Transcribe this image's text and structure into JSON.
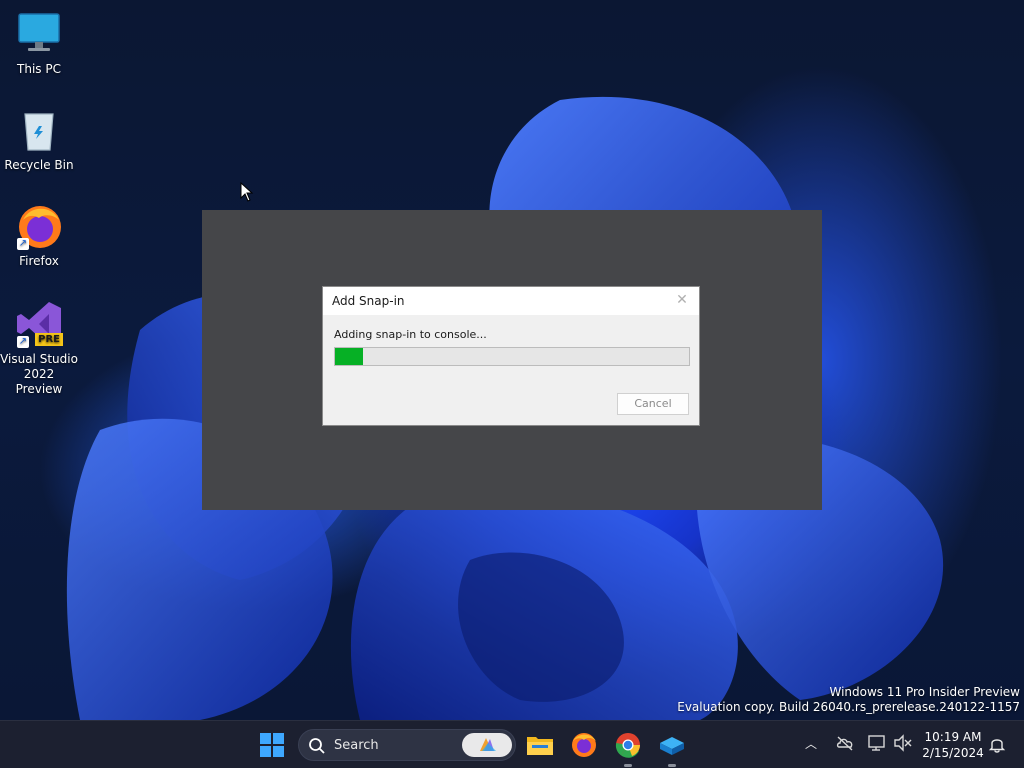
{
  "desktop": {
    "icons": [
      {
        "label": "This PC"
      },
      {
        "label": "Recycle Bin"
      },
      {
        "label": "Firefox"
      },
      {
        "label": "Visual Studio 2022 Preview",
        "badge": "PRE"
      }
    ]
  },
  "dialog": {
    "title": "Add Snap-in",
    "message": "Adding snap-in to console...",
    "progress_fraction": 0.08,
    "cancel_label": "Cancel",
    "progress_color": "#06b025"
  },
  "watermark": {
    "line1": "Windows 11 Pro Insider Preview",
    "line2": "Evaluation copy. Build 26040.rs_prerelease.240122-1157"
  },
  "taskbar": {
    "search_label": "Search",
    "pinned": [
      {
        "name": "start-icon"
      },
      {
        "name": "file-explorer-icon"
      },
      {
        "name": "firefox-icon"
      },
      {
        "name": "chrome-icon"
      },
      {
        "name": "mmc-icon"
      }
    ],
    "clock_time": "10:19 AM",
    "clock_date": "2/15/2024"
  }
}
